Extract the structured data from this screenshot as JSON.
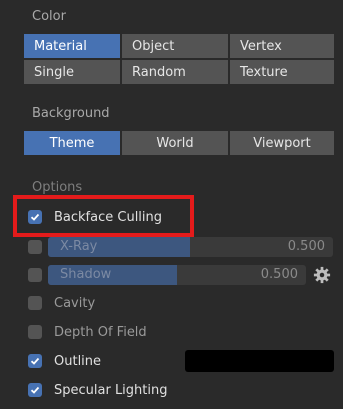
{
  "color": {
    "label": "Color",
    "options": [
      "Material",
      "Object",
      "Vertex",
      "Single",
      "Random",
      "Texture"
    ],
    "selected": "Material"
  },
  "background": {
    "label": "Background",
    "options": [
      "Theme",
      "World",
      "Viewport"
    ],
    "selected": "Theme"
  },
  "options": {
    "label": "Options",
    "backface_culling": {
      "label": "Backface Culling",
      "checked": true
    },
    "xray": {
      "label": "X-Ray",
      "value": "0.500",
      "checked": false
    },
    "shadow": {
      "label": "Shadow",
      "value": "0.500",
      "checked": false
    },
    "cavity": {
      "label": "Cavity",
      "checked": false
    },
    "depth_of_field": {
      "label": "Depth Of Field",
      "checked": false
    },
    "outline": {
      "label": "Outline",
      "checked": true,
      "color": "#000000"
    },
    "specular_lighting": {
      "label": "Specular Lighting",
      "checked": true
    }
  },
  "colors": {
    "accent": "#4772b3",
    "highlight": "#e41b1b"
  }
}
